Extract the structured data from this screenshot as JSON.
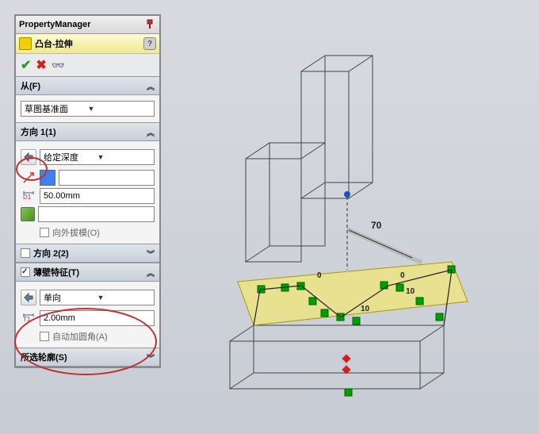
{
  "header": {
    "title": "PropertyManager"
  },
  "feature": {
    "title": "凸台-拉伸"
  },
  "from": {
    "head": "从(F)",
    "plane": "草图基准面"
  },
  "dir1": {
    "head": "方向 1(1)",
    "mode": "给定深度",
    "depth": "50.00mm",
    "draft_label": "向外拔模(O)"
  },
  "dir2": {
    "head": "方向 2(2)"
  },
  "thin": {
    "head": "薄壁特征(T)",
    "mode": "单向",
    "thickness": "2.00mm",
    "fillet_label": "自动加圆角(A)"
  },
  "contours": {
    "head": "所选轮廓(S)"
  },
  "dims": {
    "d70": "70",
    "d10a": "10",
    "d10b": "10",
    "d0a": "0",
    "d0b": "0"
  }
}
